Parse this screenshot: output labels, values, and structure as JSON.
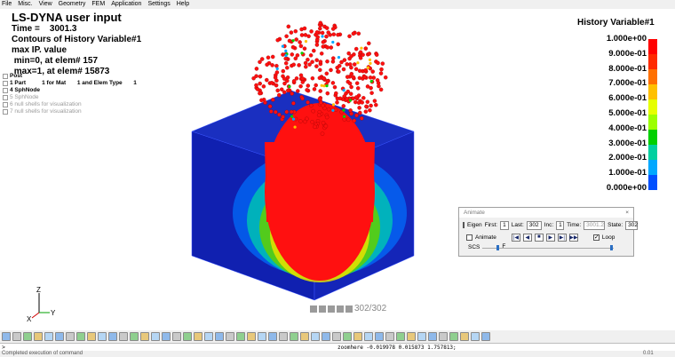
{
  "menu": [
    "File",
    "Misc.",
    "View",
    "Geometry",
    "FEM",
    "Application",
    "Settings",
    "Help"
  ],
  "header": {
    "title": "LS-DYNA user input",
    "time_label": "Time =",
    "time_value": "3001.3",
    "contours": "Contours of History Variable#1",
    "max_ip": "max IP. value",
    "min_line": " min=0, at elem# 157",
    "max_line": " max=1, at elem# 15873"
  },
  "parts_tree": {
    "root": "Post",
    "items": [
      {
        "text": "1 Part          1 for Mat       1 and Elem Type       1",
        "dim": false
      },
      {
        "text": "4 SphNode",
        "dim": false
      },
      {
        "text": "5 SphNode",
        "dim": true
      },
      {
        "text": "6 null shells for visualization",
        "dim": true
      },
      {
        "text": "7 null shells for visualization",
        "dim": true
      }
    ]
  },
  "legend": {
    "title": "History Variable#1",
    "labels": [
      "1.000e+00",
      "9.000e-01",
      "8.000e-01",
      "7.000e-01",
      "6.000e-01",
      "5.000e-01",
      "4.000e-01",
      "3.000e-01",
      "2.000e-01",
      "1.000e-01",
      "0.000e+00"
    ],
    "colors": [
      "#ff0000",
      "#ff2a00",
      "#ff7000",
      "#ffc000",
      "#e6ff00",
      "#9cff00",
      "#00d000",
      "#00d0a0",
      "#00a8ff",
      "#0050ff",
      "#0000d0"
    ]
  },
  "viewport": {
    "cube_color": "#1020b0",
    "particle_color": "#ff1010"
  },
  "playback": {
    "frame": "302/302"
  },
  "animate_dialog": {
    "title": "Animate",
    "eigen_label": "Eigen",
    "first_label": "First:",
    "first_value": "1",
    "last_label": "Last:",
    "last_value": "302",
    "inc_label": "Inc:",
    "inc_value": "1",
    "time_label": "Time:",
    "time_value": "3001.2",
    "state_label": "State:",
    "state_value": "302",
    "animate_label": "Animate",
    "loop_label": "Loop",
    "speed_s": "SCS",
    "speed_f": "F"
  },
  "command": {
    "prompt": ">",
    "output": "zoomhere -0.019978 0.015873 1.757813;"
  },
  "status": {
    "text": "Completed execution of command",
    "cpu": "0.01"
  }
}
